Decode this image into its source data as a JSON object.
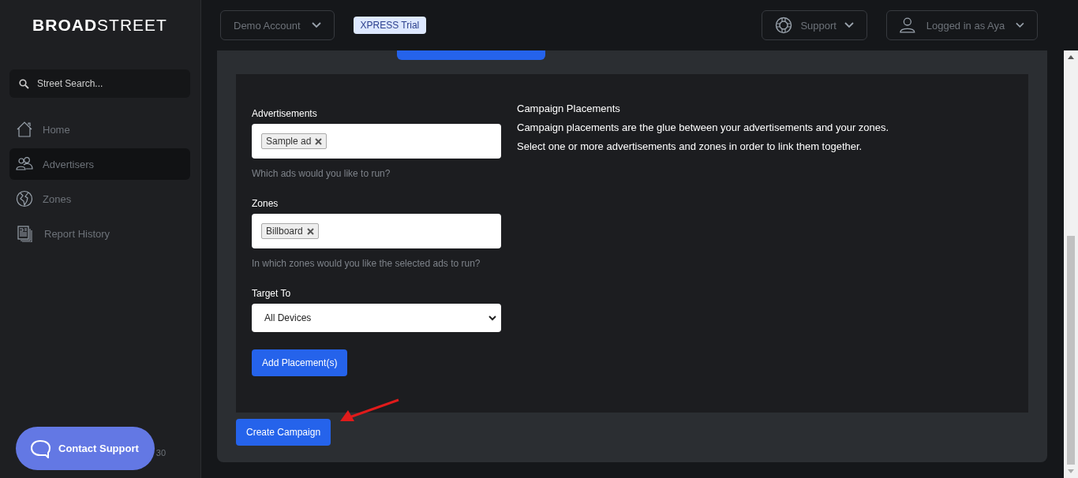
{
  "brand": {
    "bold": "BROAD",
    "light": "STREET"
  },
  "search": {
    "placeholder": "Street Search..."
  },
  "nav": [
    {
      "label": "Home",
      "selected": false
    },
    {
      "label": "Advertisers",
      "selected": true
    },
    {
      "label": "Zones",
      "selected": false
    },
    {
      "label": "Report History",
      "selected": false
    }
  ],
  "contact_support": {
    "label": "Contact Support"
  },
  "version_fragment": "30",
  "header": {
    "account": "Demo Account",
    "badge": "XPRESS Trial",
    "support": "Support",
    "user": "Logged in as Aya"
  },
  "form": {
    "fields": [
      {
        "kind": "tags",
        "label": "Advertisements",
        "tags": [
          "Sample ad"
        ],
        "help": "Which ads would you like to run?"
      },
      {
        "kind": "tags",
        "label": "Zones",
        "tags": [
          "Billboard"
        ],
        "help": "In which zones would you like the selected ads to run?"
      },
      {
        "kind": "select",
        "label": "Target To",
        "value": "All Devices"
      }
    ],
    "add_button": "Add Placement(s)"
  },
  "info": {
    "title": "Campaign Placements",
    "lines": [
      "Campaign placements are the glue between your advertisements and your zones.",
      "Select one or more advertisements and zones in order to link them together."
    ]
  },
  "create_button": "Create Campaign"
}
